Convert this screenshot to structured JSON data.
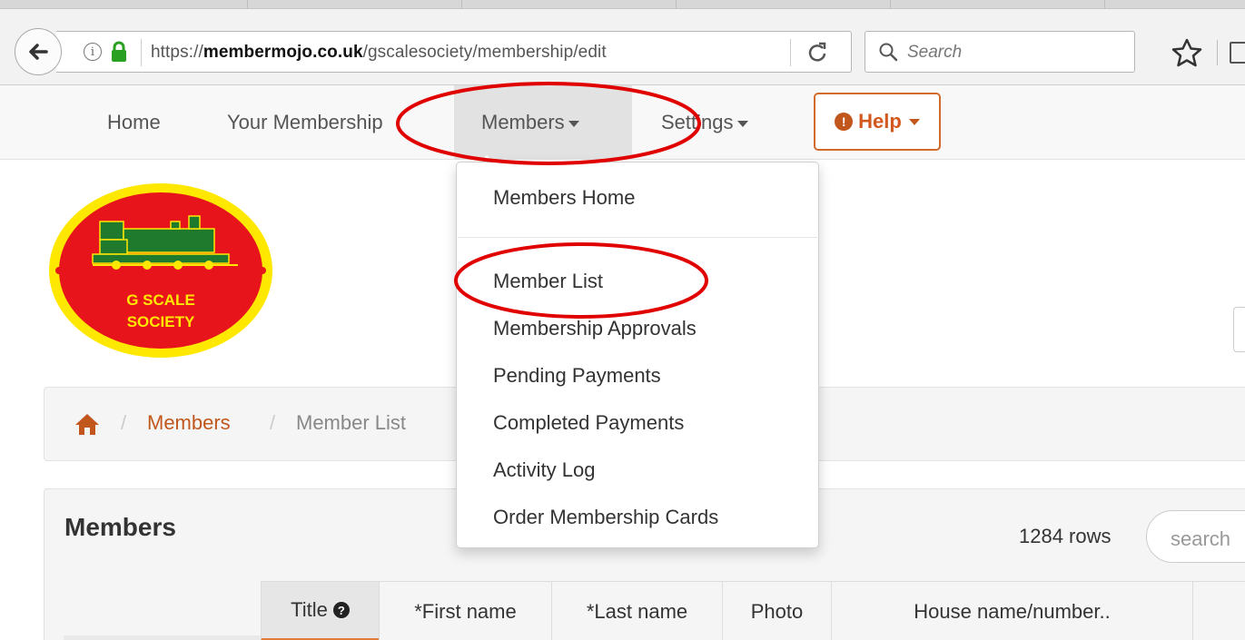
{
  "browser": {
    "url_prefix": "https://",
    "url_domain": "membermojo.co.uk",
    "url_path": "/gscalesociety/membership/edit",
    "search_placeholder": "Search"
  },
  "nav": {
    "items": [
      {
        "label": "Home"
      },
      {
        "label": "Your Membership"
      },
      {
        "label": "Members"
      },
      {
        "label": "Settings"
      }
    ],
    "help_label": "Help"
  },
  "logo": {
    "line1": "G SCALE",
    "line2": "SOCIETY"
  },
  "dropdown": {
    "items": [
      {
        "label": "Members Home"
      },
      {
        "label": "Member List"
      },
      {
        "label": "Membership Approvals"
      },
      {
        "label": "Pending Payments"
      },
      {
        "label": "Completed Payments"
      },
      {
        "label": "Activity Log"
      },
      {
        "label": "Order Membership Cards"
      }
    ]
  },
  "breadcrumb": {
    "link": "Members",
    "current": "Member List",
    "separator": "/"
  },
  "panel": {
    "title": "Members",
    "rows_count": "1284 rows",
    "search_placeholder": "search"
  },
  "table": {
    "columns": [
      {
        "label": "Title"
      },
      {
        "label": "*First name"
      },
      {
        "label": "*Last name"
      },
      {
        "label": "Photo"
      },
      {
        "label": "House name/number.."
      }
    ]
  },
  "colors": {
    "accent": "#c1571d",
    "annotation": "#e00000",
    "logo_red": "#e8141c",
    "logo_yellow": "#ffe800",
    "logo_green": "#1f7a2e"
  }
}
